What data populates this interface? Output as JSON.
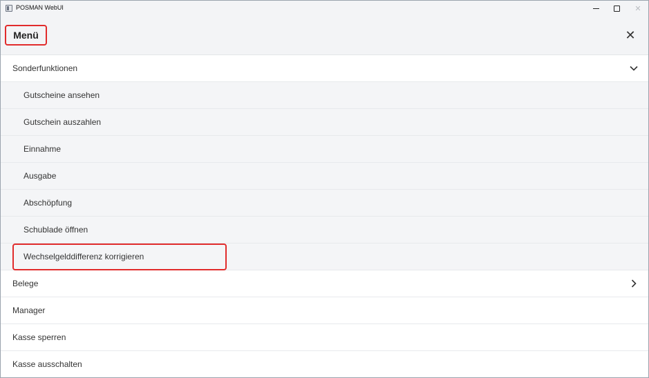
{
  "window": {
    "title": "POSMAN WebUI",
    "controls": {
      "minimize": "—",
      "maximize": "□",
      "close": "✕"
    }
  },
  "menu": {
    "title": "Menü",
    "close_glyph": "✕",
    "groups": [
      {
        "label": "Sonderfunktionen",
        "expanded": true,
        "chevron": "chevron-down-icon",
        "items": [
          {
            "label": "Gutscheine ansehen"
          },
          {
            "label": "Gutschein auszahlen"
          },
          {
            "label": "Einnahme"
          },
          {
            "label": "Ausgabe"
          },
          {
            "label": "Abschöpfung"
          },
          {
            "label": "Schublade öffnen"
          },
          {
            "label": "Wechselgelddifferenz korrigieren",
            "highlighted": true
          }
        ]
      },
      {
        "label": "Belege",
        "expanded": false,
        "chevron": "chevron-right-icon"
      },
      {
        "label": "Manager"
      },
      {
        "label": "Kasse sperren"
      },
      {
        "label": "Kasse ausschalten"
      }
    ]
  },
  "colors": {
    "highlight": "#e12b2b",
    "header_bg": "#f3f4f6",
    "submenu_bg": "#f4f5f7"
  }
}
